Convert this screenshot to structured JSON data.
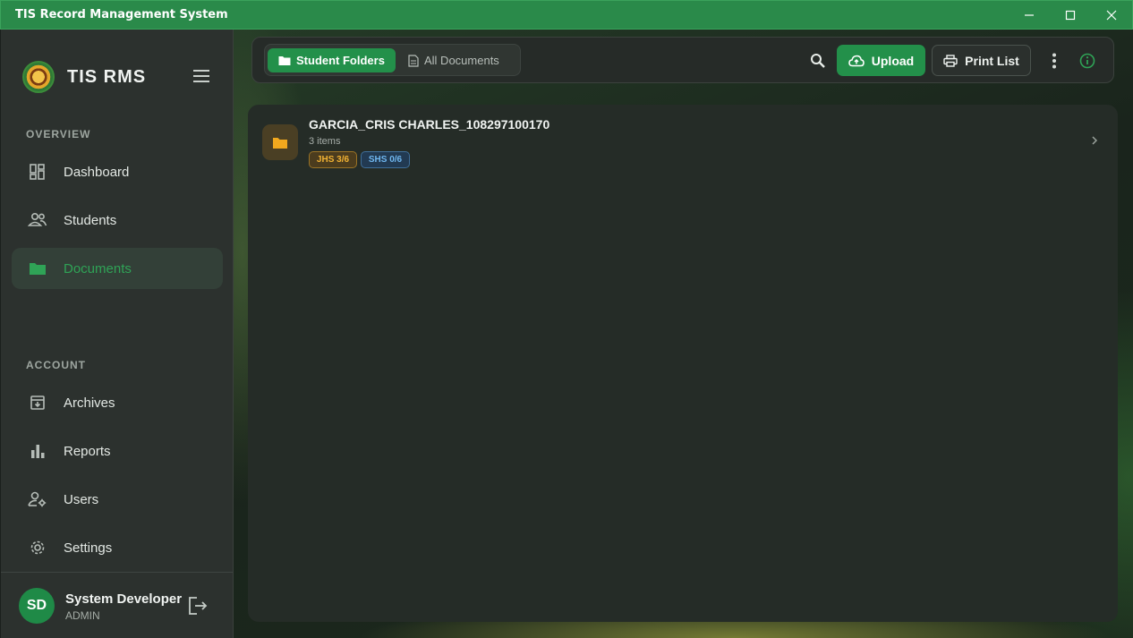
{
  "window": {
    "title": "TIS Record Management System"
  },
  "sidebar": {
    "brand": "TIS RMS",
    "sections": {
      "overview": "OVERVIEW",
      "account": "ACCOUNT"
    },
    "items": [
      {
        "label": "Dashboard",
        "icon": "dashboard-icon"
      },
      {
        "label": "Students",
        "icon": "people-icon"
      },
      {
        "label": "Documents",
        "icon": "folder-icon",
        "active": true
      },
      {
        "label": "Archives",
        "icon": "archive-icon"
      },
      {
        "label": "Reports",
        "icon": "bar-chart-icon"
      },
      {
        "label": "Users",
        "icon": "user-gear-icon"
      },
      {
        "label": "Settings",
        "icon": "gear-icon"
      }
    ],
    "user": {
      "initials": "SD",
      "name": "System Developer",
      "role": "ADMIN"
    }
  },
  "toolbar": {
    "tabs": [
      {
        "label": "Student Folders",
        "active": true
      },
      {
        "label": "All Documents",
        "active": false
      }
    ],
    "upload_label": "Upload",
    "print_label": "Print List"
  },
  "folders": [
    {
      "name": "GARCIA_CRIS CHARLES_108297100170",
      "count": "3 items",
      "badges": [
        {
          "label": "JHS 3/6",
          "color": "#f1b233"
        },
        {
          "label": "SHS 0/6",
          "color": "#6fb6ee"
        }
      ]
    }
  ],
  "colors": {
    "accent": "#23904a",
    "titlebar": "#2a8a4a"
  }
}
